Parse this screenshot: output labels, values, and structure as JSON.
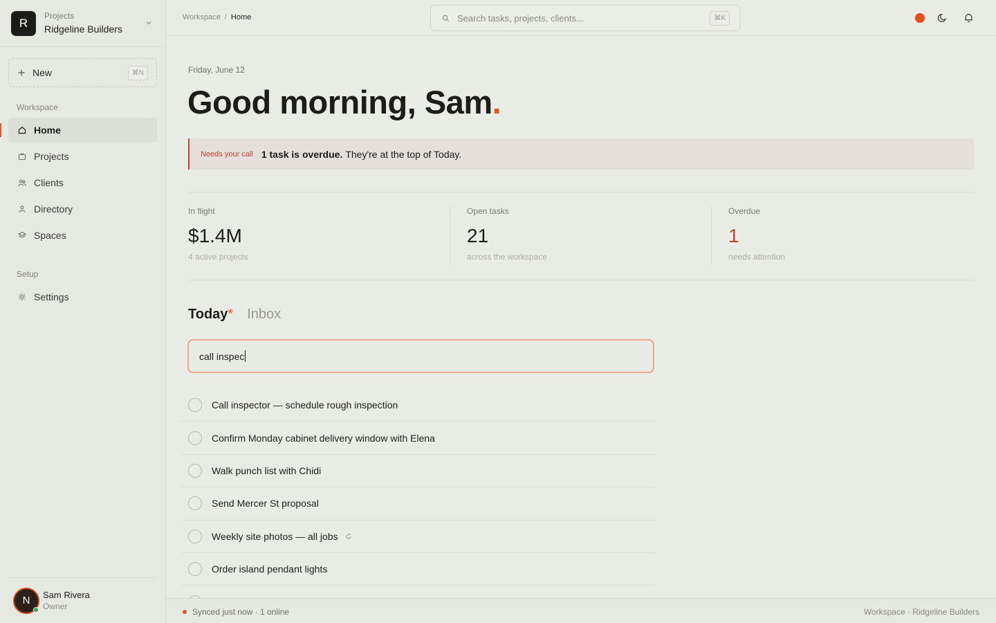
{
  "org": {
    "logo_letter": "R",
    "kicker": "Projects",
    "name": "Ridgeline Builders"
  },
  "sidebar": {
    "new_label": "New",
    "new_shortcut": "⌘N",
    "workspace_heading": "Workspace",
    "items": [
      {
        "label": "Home",
        "icon": "home-icon",
        "active": true
      },
      {
        "label": "Projects",
        "icon": "briefcase-icon"
      },
      {
        "label": "Clients",
        "icon": "users-icon"
      },
      {
        "label": "Directory",
        "icon": "person-icon"
      },
      {
        "label": "Spaces",
        "icon": "layers-icon"
      }
    ],
    "setup_heading": "Setup",
    "setup_items": [
      {
        "label": "Settings",
        "icon": "gear-icon"
      }
    ]
  },
  "user": {
    "initial": "N",
    "name": "Sam Rivera",
    "role": "Owner"
  },
  "topbar": {
    "breadcrumb": [
      "Workspace",
      "Home"
    ],
    "search_placeholder": "Search tasks, projects, clients...",
    "search_shortcut": "⌘K",
    "icons": [
      "status-dot",
      "moon-icon",
      "bell-icon"
    ]
  },
  "main": {
    "date": "Friday, June 12",
    "greeting": "Good morning, Sam",
    "greeting_punct": ".",
    "alert": {
      "tag": "Needs your call",
      "strong": "1 task is overdue.",
      "text": "They're at the top of Today."
    },
    "stats": [
      {
        "label": "In flight",
        "value": "$1.4M",
        "sub": "4 active projects"
      },
      {
        "label": "Open tasks",
        "value": "21",
        "sub": "across the workspace"
      },
      {
        "label": "Overdue",
        "value": "1",
        "sub": "needs attention"
      }
    ],
    "tabs": [
      {
        "label": "Today",
        "marker": "*"
      },
      {
        "label": "Inbox"
      }
    ],
    "task_input_value": "call inspec",
    "tasks": [
      {
        "title": "Call inspector — schedule rough inspection"
      },
      {
        "title": "Confirm Monday cabinet delivery window with Elena"
      },
      {
        "title": "Walk punch list with Chidi"
      },
      {
        "title": "Send Mercer St proposal"
      },
      {
        "title": "Weekly site photos — all jobs",
        "repeat": true
      },
      {
        "title": "Order island pendant lights"
      }
    ]
  },
  "footer": {
    "sync": "Synced just now · 1 online",
    "right": "Workspace · Ridgeline Builders"
  },
  "colors": {
    "accent": "#e0561e",
    "danger": "#c8402a",
    "background": "#e9ebe5"
  }
}
